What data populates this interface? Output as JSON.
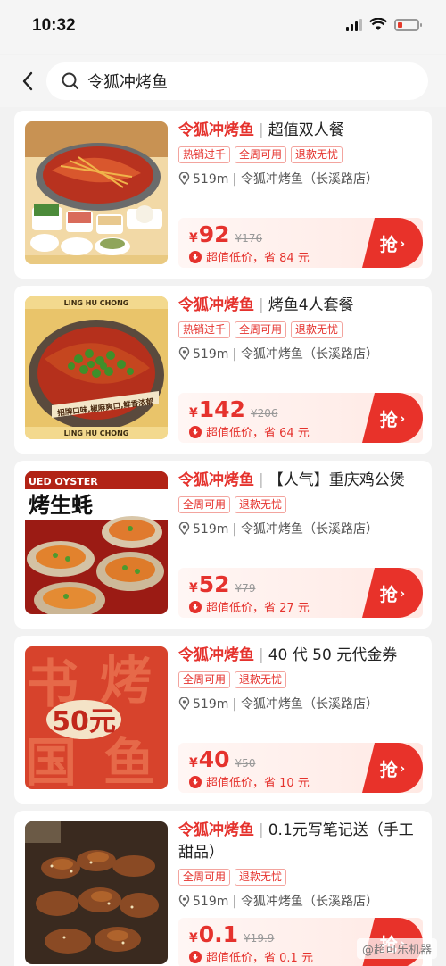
{
  "status": {
    "time": "10:32"
  },
  "search": {
    "query": "令狐冲烤鱼"
  },
  "colors": {
    "accent": "#e5322d"
  },
  "cards": [
    {
      "shop": "令狐冲烤鱼",
      "name": "超值双人餐",
      "tags": [
        "热销过千",
        "全周可用",
        "退款无忧"
      ],
      "location": "519m | 令狐冲烤鱼（长溪路店）",
      "yen": "¥",
      "price": "92",
      "original": "¥176",
      "saving": "超值低价，省 84 元",
      "button": "抢"
    },
    {
      "shop": "令狐冲烤鱼",
      "name": "烤鱼4人套餐",
      "tags": [
        "热销过千",
        "全周可用",
        "退款无忧"
      ],
      "location": "519m | 令狐冲烤鱼（长溪路店）",
      "yen": "¥",
      "price": "142",
      "original": "¥206",
      "saving": "超值低价，省 64 元",
      "button": "抢",
      "image_text": {
        "top": "LING HU CHONG",
        "banner": "招牌口味,椒麻爽口,鲜香浓郁"
      }
    },
    {
      "shop": "令狐冲烤鱼",
      "name": "【人气】重庆鸡公煲",
      "tags": [
        "全周可用",
        "退款无忧"
      ],
      "location": "519m | 令狐冲烤鱼（长溪路店）",
      "yen": "¥",
      "price": "52",
      "original": "¥79",
      "saving": "超值低价，省 27 元",
      "button": "抢",
      "image_text": {
        "top": "UED OYSTER",
        "big": "烤生蚝"
      }
    },
    {
      "shop": "令狐冲烤鱼",
      "name": "40 代 50 元代金券",
      "tags": [
        "全周可用",
        "退款无忧"
      ],
      "location": "519m | 令狐冲烤鱼（长溪路店）",
      "yen": "¥",
      "price": "40",
      "original": "¥50",
      "saving": "超值低价，省 10 元",
      "button": "抢",
      "image_text": {
        "big": "50元"
      }
    },
    {
      "shop": "令狐冲烤鱼",
      "name": "0.1元写笔记送（手工甜品）",
      "tags": [
        "全周可用",
        "退款无忧"
      ],
      "location": "519m | 令狐冲烤鱼（长溪路店）",
      "yen": "¥",
      "price": "0.1",
      "original": "¥19.9",
      "saving": "超值低价，省 0.1 元",
      "button": "抢"
    }
  ],
  "watermark": "@超可乐机器"
}
